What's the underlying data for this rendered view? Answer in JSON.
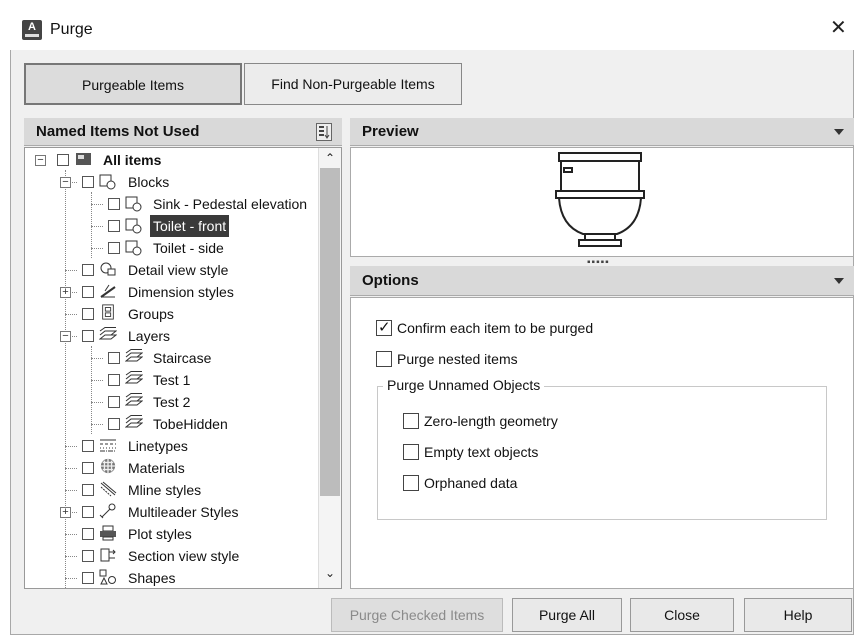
{
  "window": {
    "title": "Purge",
    "close_glyph": "✕"
  },
  "tabs": [
    {
      "label": "Purgeable Items",
      "active": true
    },
    {
      "label": "Find Non-Purgeable Items",
      "active": false
    }
  ],
  "left_panel": {
    "title": "Named Items Not Used"
  },
  "tree": [
    {
      "label": "All items",
      "bold": true
    },
    {
      "label": "Blocks"
    },
    {
      "label": "Sink - Pedestal elevation"
    },
    {
      "label": "Toilet - front",
      "selected": true
    },
    {
      "label": "Toilet - side"
    },
    {
      "label": "Detail view style"
    },
    {
      "label": "Dimension styles"
    },
    {
      "label": "Groups"
    },
    {
      "label": "Layers"
    },
    {
      "label": "Staircase"
    },
    {
      "label": "Test 1"
    },
    {
      "label": "Test 2"
    },
    {
      "label": "TobeHidden"
    },
    {
      "label": "Linetypes"
    },
    {
      "label": "Materials"
    },
    {
      "label": "Mline styles"
    },
    {
      "label": "Multileader Styles"
    },
    {
      "label": "Plot styles"
    },
    {
      "label": "Section view style"
    },
    {
      "label": "Shapes"
    }
  ],
  "preview": {
    "title": "Preview"
  },
  "options": {
    "title": "Options",
    "confirm": {
      "label": "Confirm each item to be purged",
      "checked": true
    },
    "nested": {
      "label": "Purge nested items",
      "checked": false
    },
    "group_title": "Purge Unnamed Objects",
    "zero_length": {
      "label": "Zero-length geometry",
      "checked": false
    },
    "empty_text": {
      "label": "Empty text objects",
      "checked": false
    },
    "orphaned": {
      "label": "Orphaned data",
      "checked": false
    }
  },
  "buttons": {
    "purge_checked": "Purge Checked Items",
    "purge_all": "Purge All",
    "close": "Close",
    "help": "Help"
  }
}
